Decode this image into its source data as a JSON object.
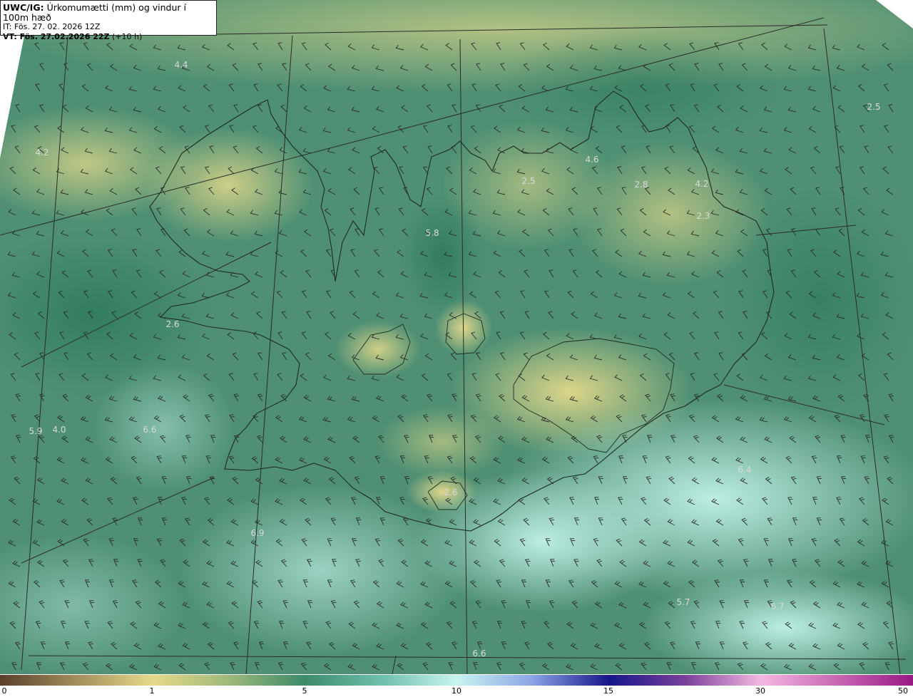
{
  "header": {
    "product": "UWC/IG:",
    "title": " Úrkomumætti (mm) og vindur í 100m hæð",
    "init_time": "IT: Fös. 27. 02. 2026 12Z",
    "valid_label": "VT: Fös. 27.02.2026 22Z",
    "valid_offset": " (+10 h)"
  },
  "colors": {
    "low": "#d8d068",
    "mid": "#3e8a6c",
    "high": "#b9f2ea",
    "coast": "#1e2a20",
    "grid": "#2b2b2b",
    "barb": "#2a2a2a"
  },
  "value_labels": [
    {
      "text": "4.4"
    },
    {
      "text": "4.2"
    },
    {
      "text": "2.5"
    },
    {
      "text": "4.6"
    },
    {
      "text": "2.5"
    },
    {
      "text": "2.8"
    },
    {
      "text": "4.2"
    },
    {
      "text": "2.3"
    },
    {
      "text": "5.8"
    },
    {
      "text": "2.6"
    },
    {
      "text": "5.9"
    },
    {
      "text": "4.0"
    },
    {
      "text": "6.6"
    },
    {
      "text": "2.6"
    },
    {
      "text": "6.9"
    },
    {
      "text": "6.4"
    },
    {
      "text": "5.7"
    },
    {
      "text": "6.7"
    },
    {
      "text": "6.6"
    }
  ],
  "colorbar": {
    "ticks": [
      "0",
      "1",
      "5",
      "10",
      "15",
      "30",
      "50"
    ]
  }
}
